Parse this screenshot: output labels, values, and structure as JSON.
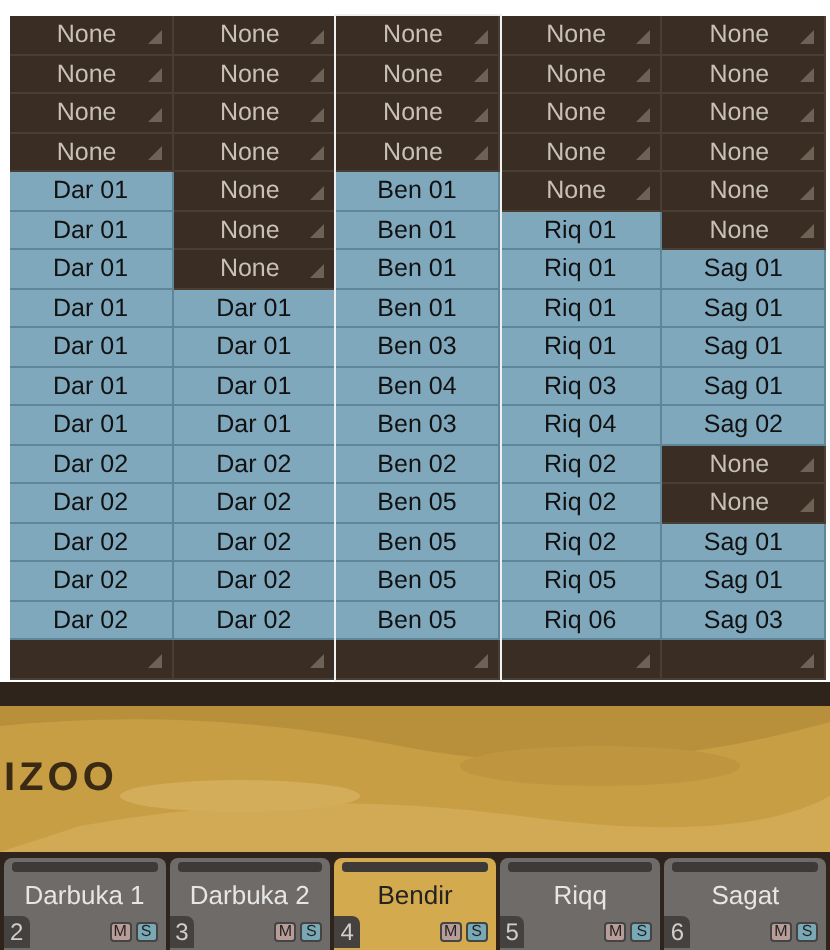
{
  "grid": {
    "rows": [
      [
        {
          "text": "None",
          "kind": "none"
        },
        {
          "text": "None",
          "kind": "none"
        },
        {
          "text": "None",
          "kind": "none"
        },
        {
          "text": "None",
          "kind": "none"
        },
        {
          "text": "None",
          "kind": "none"
        }
      ],
      [
        {
          "text": "None",
          "kind": "none"
        },
        {
          "text": "None",
          "kind": "none"
        },
        {
          "text": "None",
          "kind": "none"
        },
        {
          "text": "None",
          "kind": "none"
        },
        {
          "text": "None",
          "kind": "none"
        }
      ],
      [
        {
          "text": "None",
          "kind": "none"
        },
        {
          "text": "None",
          "kind": "none"
        },
        {
          "text": "None",
          "kind": "none"
        },
        {
          "text": "None",
          "kind": "none"
        },
        {
          "text": "None",
          "kind": "none"
        }
      ],
      [
        {
          "text": "None",
          "kind": "none"
        },
        {
          "text": "None",
          "kind": "none"
        },
        {
          "text": "None",
          "kind": "none"
        },
        {
          "text": "None",
          "kind": "none"
        },
        {
          "text": "None",
          "kind": "none"
        }
      ],
      [
        {
          "text": "Dar 01",
          "kind": "pattern"
        },
        {
          "text": "None",
          "kind": "none"
        },
        {
          "text": "Ben 01",
          "kind": "pattern"
        },
        {
          "text": "None",
          "kind": "none"
        },
        {
          "text": "None",
          "kind": "none"
        }
      ],
      [
        {
          "text": "Dar 01",
          "kind": "pattern"
        },
        {
          "text": "None",
          "kind": "none"
        },
        {
          "text": "Ben 01",
          "kind": "pattern"
        },
        {
          "text": "Riq 01",
          "kind": "pattern"
        },
        {
          "text": "None",
          "kind": "none"
        }
      ],
      [
        {
          "text": "Dar 01",
          "kind": "pattern"
        },
        {
          "text": "None",
          "kind": "none"
        },
        {
          "text": "Ben 01",
          "kind": "pattern"
        },
        {
          "text": "Riq 01",
          "kind": "pattern"
        },
        {
          "text": "Sag 01",
          "kind": "pattern"
        }
      ],
      [
        {
          "text": "Dar 01",
          "kind": "pattern"
        },
        {
          "text": "Dar 01",
          "kind": "pattern"
        },
        {
          "text": "Ben 01",
          "kind": "pattern"
        },
        {
          "text": "Riq 01",
          "kind": "pattern"
        },
        {
          "text": "Sag 01",
          "kind": "pattern"
        }
      ],
      [
        {
          "text": "Dar 01",
          "kind": "pattern"
        },
        {
          "text": "Dar 01",
          "kind": "pattern"
        },
        {
          "text": "Ben 03",
          "kind": "pattern"
        },
        {
          "text": "Riq 01",
          "kind": "pattern"
        },
        {
          "text": "Sag 01",
          "kind": "pattern"
        }
      ],
      [
        {
          "text": "Dar 01",
          "kind": "pattern"
        },
        {
          "text": "Dar 01",
          "kind": "pattern"
        },
        {
          "text": "Ben 04",
          "kind": "pattern"
        },
        {
          "text": "Riq 03",
          "kind": "pattern"
        },
        {
          "text": "Sag 01",
          "kind": "pattern"
        }
      ],
      [
        {
          "text": "Dar 01",
          "kind": "pattern"
        },
        {
          "text": "Dar 01",
          "kind": "pattern"
        },
        {
          "text": "Ben 03",
          "kind": "pattern"
        },
        {
          "text": "Riq 04",
          "kind": "pattern"
        },
        {
          "text": "Sag 02",
          "kind": "pattern"
        }
      ],
      [
        {
          "text": "Dar 02",
          "kind": "pattern"
        },
        {
          "text": "Dar 02",
          "kind": "pattern"
        },
        {
          "text": "Ben 02",
          "kind": "pattern"
        },
        {
          "text": "Riq 02",
          "kind": "pattern"
        },
        {
          "text": "None",
          "kind": "none"
        }
      ],
      [
        {
          "text": "Dar 02",
          "kind": "pattern"
        },
        {
          "text": "Dar 02",
          "kind": "pattern"
        },
        {
          "text": "Ben 05",
          "kind": "pattern"
        },
        {
          "text": "Riq 02",
          "kind": "pattern"
        },
        {
          "text": "None",
          "kind": "none"
        }
      ],
      [
        {
          "text": "Dar 02",
          "kind": "pattern"
        },
        {
          "text": "Dar 02",
          "kind": "pattern"
        },
        {
          "text": "Ben 05",
          "kind": "pattern"
        },
        {
          "text": "Riq 02",
          "kind": "pattern"
        },
        {
          "text": "Sag 01",
          "kind": "pattern"
        }
      ],
      [
        {
          "text": "Dar 02",
          "kind": "pattern"
        },
        {
          "text": "Dar 02",
          "kind": "pattern"
        },
        {
          "text": "Ben 05",
          "kind": "pattern"
        },
        {
          "text": "Riq 05",
          "kind": "pattern"
        },
        {
          "text": "Sag 01",
          "kind": "pattern"
        }
      ],
      [
        {
          "text": "Dar 02",
          "kind": "pattern"
        },
        {
          "text": "Dar 02",
          "kind": "pattern"
        },
        {
          "text": "Ben 05",
          "kind": "pattern"
        },
        {
          "text": "Riq 06",
          "kind": "pattern"
        },
        {
          "text": "Sag 03",
          "kind": "pattern"
        }
      ],
      [
        {
          "kind": "empty"
        },
        {
          "kind": "empty"
        },
        {
          "kind": "empty"
        },
        {
          "kind": "empty"
        },
        {
          "kind": "empty"
        }
      ]
    ]
  },
  "banner": {
    "text": "IZOO"
  },
  "tabs": [
    {
      "label": "Darbuka 1",
      "number": "2",
      "mute": "M",
      "solo": "S",
      "selected": false
    },
    {
      "label": "Darbuka 2",
      "number": "3",
      "mute": "M",
      "solo": "S",
      "selected": false
    },
    {
      "label": "Bendir",
      "number": "4",
      "mute": "M",
      "solo": "S",
      "selected": true
    },
    {
      "label": "Riqq",
      "number": "5",
      "mute": "M",
      "solo": "S",
      "selected": false
    },
    {
      "label": "Sagat",
      "number": "6",
      "mute": "M",
      "solo": "S",
      "selected": false
    }
  ]
}
